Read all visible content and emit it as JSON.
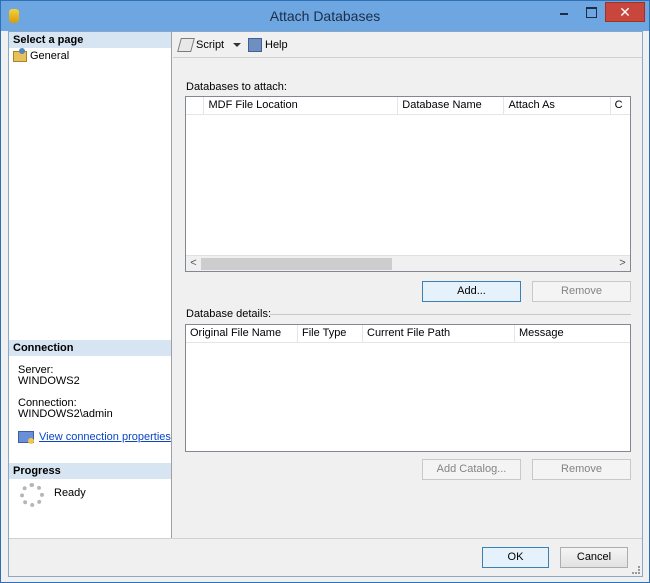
{
  "window": {
    "title": "Attach Databases",
    "close_glyph": "✕"
  },
  "left_panel": {
    "select_page_heading": "Select a page",
    "pages": [
      {
        "label": "General",
        "icon": "general-page-icon"
      }
    ],
    "connection_heading": "Connection",
    "server_label": "Server:",
    "server_value": "WINDOWS2",
    "connection_label": "Connection:",
    "connection_value": "WINDOWS2\\admin",
    "view_connection_link": "View connection properties",
    "progress_heading": "Progress",
    "progress_status": "Ready"
  },
  "toolbar": {
    "script_label": "Script",
    "help_label": "Help"
  },
  "databases_to_attach": {
    "label": "Databases to attach:",
    "columns": [
      "MDF File Location",
      "Database Name",
      "Attach As",
      "C"
    ],
    "rows": [],
    "add_button": "Add...",
    "remove_button": "Remove",
    "scroll_left": "<",
    "scroll_right": ">"
  },
  "database_details": {
    "label": "Database details:",
    "columns": [
      "Original File Name",
      "File Type",
      "Current File Path",
      "Message"
    ],
    "rows": [],
    "add_catalog_button": "Add Catalog...",
    "remove_button": "Remove"
  },
  "footer": {
    "ok_button": "OK",
    "cancel_button": "Cancel"
  }
}
